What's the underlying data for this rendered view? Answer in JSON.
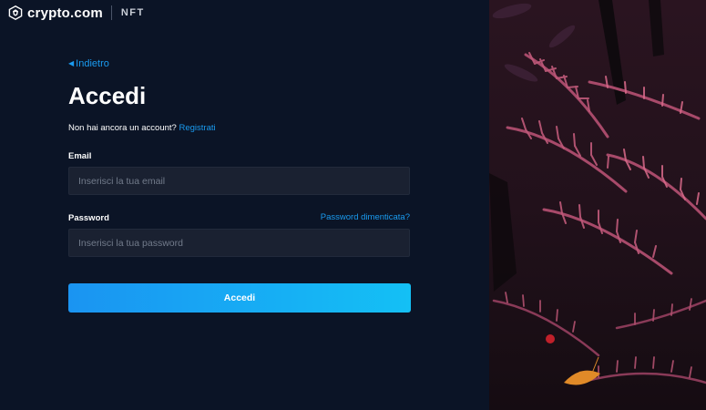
{
  "brand": {
    "name": "crypto.com",
    "product": "NFT"
  },
  "nav": {
    "back_label": "Indietro"
  },
  "page": {
    "title": "Accedi"
  },
  "signup": {
    "prompt": "Non hai ancora un account?",
    "link_label": "Registrati"
  },
  "form": {
    "email_label": "Email",
    "email_placeholder": "Inserisci la tua email",
    "email_value": "",
    "password_label": "Password",
    "password_placeholder": "Inserisci la tua password",
    "password_value": "",
    "forgot_label": "Password dimenticata?",
    "submit_label": "Accedi"
  },
  "colors": {
    "background": "#0b1426",
    "input_background": "#1a2131",
    "link": "#1a9bf0",
    "button_gradient_start": "#1a94f2",
    "button_gradient_end": "#14c0f5"
  },
  "icons": {
    "logo": "crypto-com-lion-icon",
    "back": "chevron-left-icon"
  },
  "image": {
    "subject": "fern-forest-photo"
  }
}
